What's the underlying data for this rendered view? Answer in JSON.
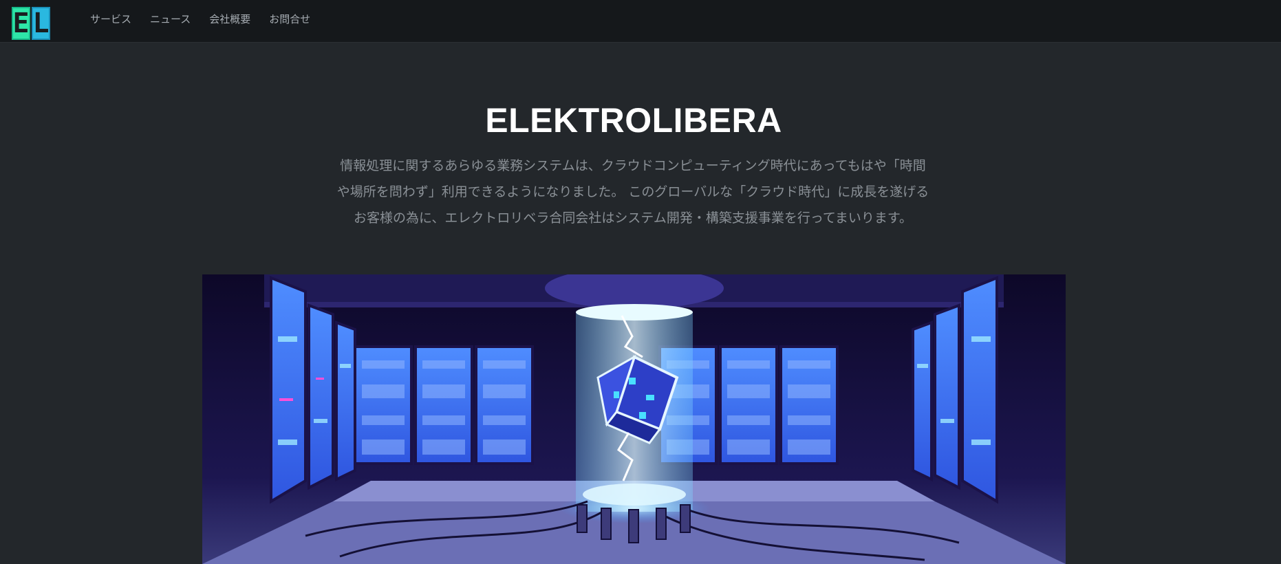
{
  "brand": {
    "logo_letters": [
      "E",
      "L"
    ],
    "colors": {
      "e": "#2ee6a8",
      "l": "#2ab8e0"
    }
  },
  "nav": {
    "items": [
      {
        "label": "サービス"
      },
      {
        "label": "ニュース"
      },
      {
        "label": "会社概要"
      },
      {
        "label": "お問合せ"
      }
    ]
  },
  "hero": {
    "title": "ELEKTROLIBERA",
    "description": "情報処理に関するあらゆる業務システムは、クラウドコンピューティング時代にあってもはや「時間や場所を問わず」利用できるようになりました。 このグローバルな「クラウド時代」に成長を遂げるお客様の為に、エレクトロリベラ合同会社はシステム開発・構築支援事業を行ってまいります。",
    "image": "server-room-illustration"
  },
  "colors": {
    "navbar": "#15181b",
    "background": "#23272b",
    "title": "#ffffff",
    "text": "#8a9096"
  }
}
